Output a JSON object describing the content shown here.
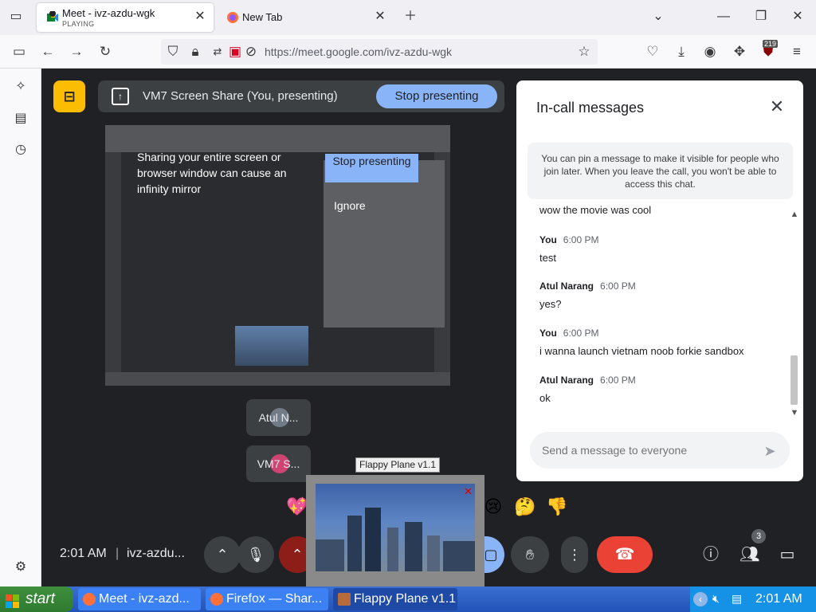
{
  "browser": {
    "tabs": [
      {
        "title": "Meet - ivz-azdu-wgk",
        "status": "PLAYING"
      },
      {
        "title": "New Tab"
      }
    ],
    "url": "https://meet.google.com/ivz-azdu-wgk",
    "extension_badge": "219"
  },
  "meet": {
    "presenting_label": "VM7 Screen Share (You, presenting)",
    "stop_presenting": "Stop presenting",
    "mirror_warning": "Sharing your entire screen or browser window can cause an infinity mirror",
    "mirror_stop": "Stop presenting",
    "mirror_ignore": "Ignore",
    "participants": [
      "Atul N...",
      "VM7 S..."
    ],
    "reactions": [
      "💖",
      "😢",
      "🤔",
      "👎"
    ],
    "time": "2:01 AM",
    "meeting_code": "ivz-azdu...",
    "people_count": "3"
  },
  "chat": {
    "title": "In-call messages",
    "pin_note": "You can pin a message to make it visible for people who join later. When you leave the call, you won't be able to access this chat.",
    "partial_message": "wow the movie was cool",
    "messages": [
      {
        "sender": "You",
        "time": "6:00 PM",
        "text": "test"
      },
      {
        "sender": "Atul Narang",
        "time": "6:00 PM",
        "text": "yes?"
      },
      {
        "sender": "You",
        "time": "6:00 PM",
        "text": "i wanna launch vietnam noob forkie sandbox"
      },
      {
        "sender": "Atul Narang",
        "time": "6:00 PM",
        "text": "ok"
      }
    ],
    "input_placeholder": "Send a message to everyone"
  },
  "flappy": {
    "tooltip": "Flappy Plane v1.1"
  },
  "taskbar": {
    "start": "start",
    "items": [
      "Meet - ivz-azd...",
      "Firefox — Shar...",
      "Flappy Plane v1.1"
    ],
    "time": "2:01 AM"
  },
  "colors": {
    "meet_bg": "#202124",
    "accent_blue": "#8ab4f8",
    "end_call_red": "#ea4335",
    "presenter_yellow": "#fbbc04",
    "taskbar_blue": "#2253b8"
  }
}
